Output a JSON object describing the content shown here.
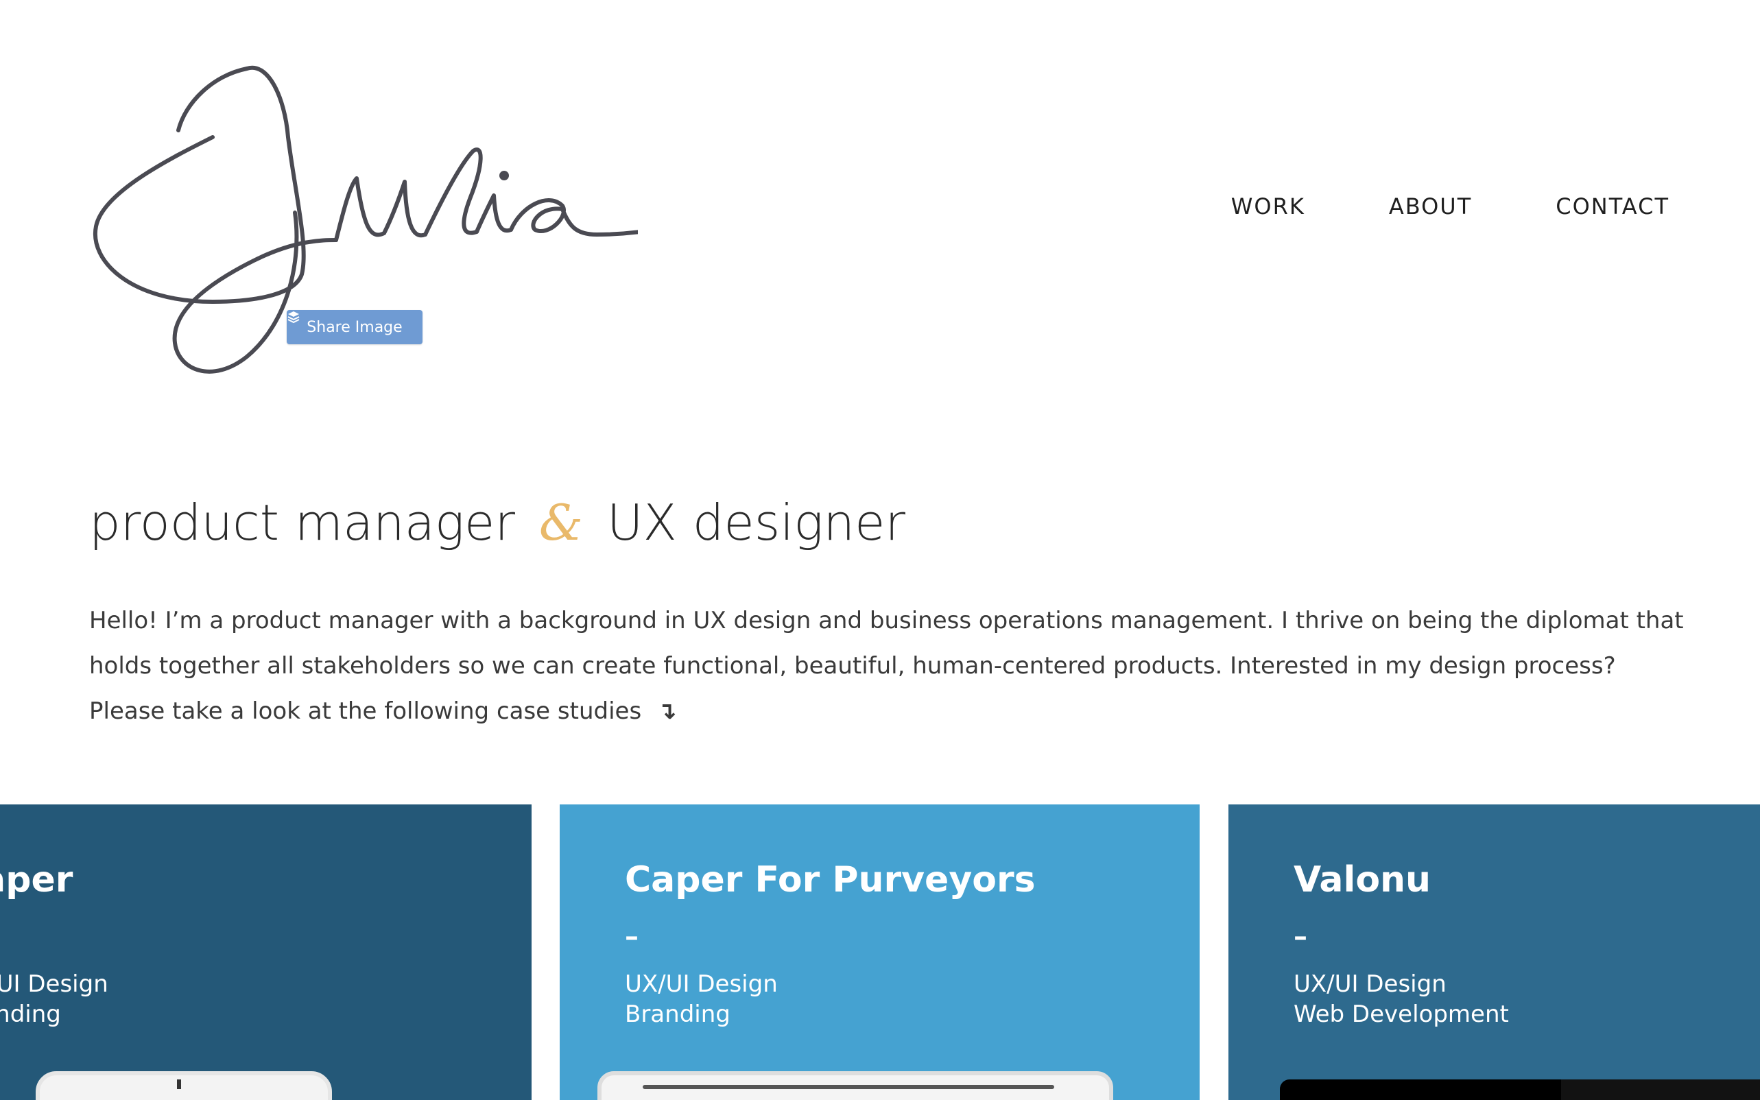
{
  "header": {
    "logo_signature_text": "Julia",
    "share_button_label": "Share Image",
    "nav": [
      {
        "label": "WORK"
      },
      {
        "label": "ABOUT"
      },
      {
        "label": "CONTACT"
      }
    ]
  },
  "hero": {
    "title_part1": "product manager",
    "ampersand": "&",
    "title_part2": "UX designer",
    "intro": "Hello! I’m a product manager with a background in UX design and business operations management. I thrive on being the diplomat that holds together all stakeholders so we can create functional, beautiful, human-centered products. Interested in my design process? Please take a look at the following case studies",
    "intro_arrow": "↴"
  },
  "cards": [
    {
      "title": "Caper",
      "dash": "–",
      "tags": [
        "UX/UI Design",
        "Branding"
      ]
    },
    {
      "title": "Caper For Purveyors",
      "dash": "–",
      "tags": [
        "UX/UI Design",
        "Branding"
      ]
    },
    {
      "title": "Valonu",
      "dash": "–",
      "tags": [
        "UX/UI Design",
        "Web Development"
      ]
    }
  ],
  "colors": {
    "card_1": "#245878",
    "card_2": "#45a2d1",
    "card_3": "#2e6a8e",
    "ampersand": "#e9b96a",
    "share_button": "#6f9bd3"
  }
}
